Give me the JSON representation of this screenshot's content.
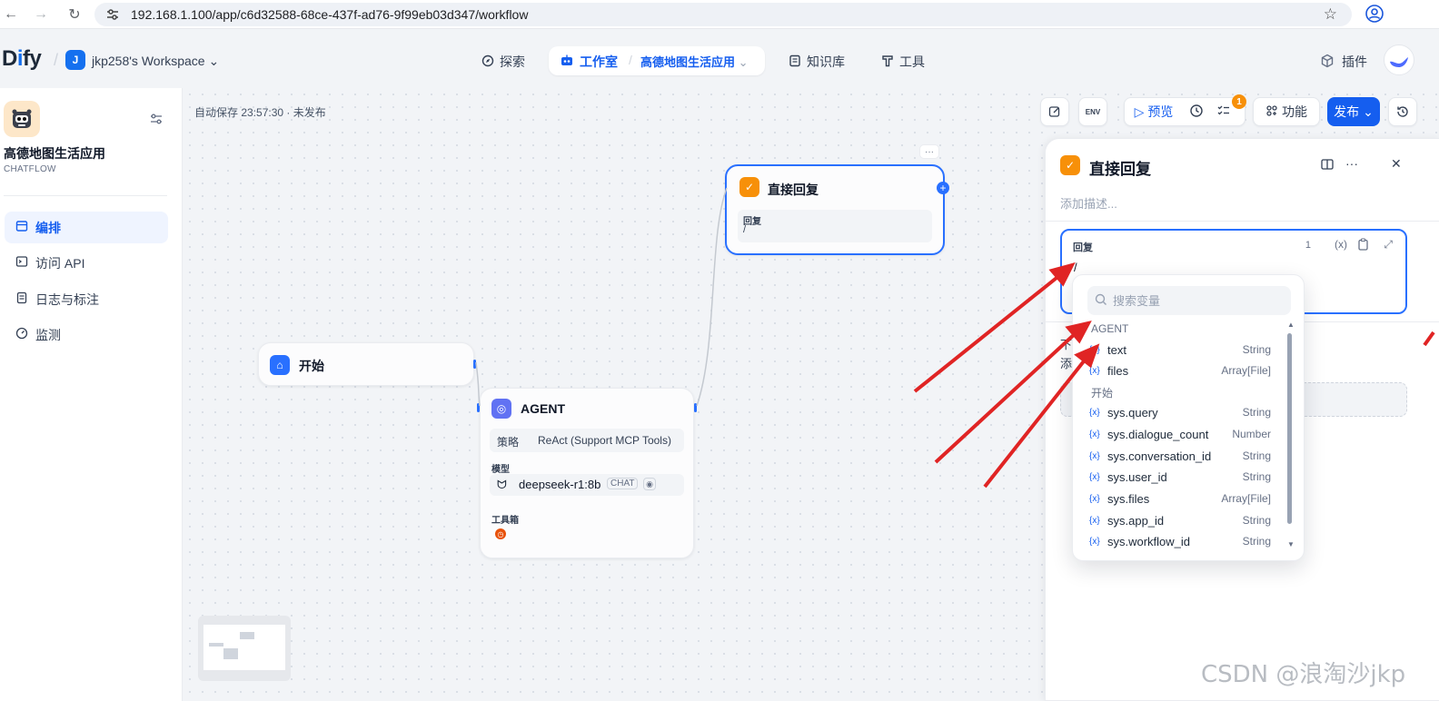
{
  "browser": {
    "url": "192.168.1.100/app/c6d32588-68ce-437f-ad76-9f99eb03d347/workflow"
  },
  "header": {
    "logo_prefix": "D",
    "logo_i": "i",
    "logo_suffix": "fy",
    "workspace_initial": "J",
    "workspace_name": "jkp258's Workspace",
    "nav": {
      "explore": "探索",
      "studio": "工作室",
      "app_name": "高德地图生活应用",
      "knowledge": "知识库",
      "tools": "工具",
      "plugins": "插件"
    }
  },
  "sidebar": {
    "app_title": "高德地图生活应用",
    "app_type": "CHATFLOW",
    "items": [
      {
        "label": "编排",
        "icon": "layout-icon"
      },
      {
        "label": "访问 API",
        "icon": "terminal-icon"
      },
      {
        "label": "日志与标注",
        "icon": "document-icon"
      },
      {
        "label": "监测",
        "icon": "gauge-icon"
      }
    ]
  },
  "canvas": {
    "autosave": "自动保存 23:57:30 · 未发布",
    "toolbar": {
      "preview": "预览",
      "features": "功能",
      "publish": "发布",
      "env": "ENV",
      "checklist_badge": "1"
    },
    "nodes": {
      "start": {
        "title": "开始"
      },
      "agent": {
        "title": "AGENT",
        "strategy_label": "策略",
        "strategy_value": "ReAct (Support MCP Tools)",
        "model_label": "模型",
        "model_name": "deepseek-r1:8b",
        "model_tag": "CHAT",
        "tools_label": "工具箱"
      },
      "answer": {
        "title": "直接回复",
        "reply_label": "回复",
        "reply_value": "/"
      }
    }
  },
  "panel": {
    "title": "直接回复",
    "description_placeholder": "添加描述...",
    "editor_label": "回复",
    "editor_count": "1",
    "editor_value": "/",
    "var_icon": "(x)",
    "behind_next_1": "下",
    "behind_next_2": "添"
  },
  "dropdown": {
    "search_placeholder": "搜索变量",
    "groups": [
      {
        "name": "AGENT",
        "vars": [
          {
            "name": "text",
            "type": "String"
          },
          {
            "name": "files",
            "type": "Array[File]"
          }
        ]
      },
      {
        "name": "开始",
        "vars": [
          {
            "name": "sys.query",
            "type": "String"
          },
          {
            "name": "sys.dialogue_count",
            "type": "Number"
          },
          {
            "name": "sys.conversation_id",
            "type": "String"
          },
          {
            "name": "sys.user_id",
            "type": "String"
          },
          {
            "name": "sys.files",
            "type": "Array[File]"
          },
          {
            "name": "sys.app_id",
            "type": "String"
          },
          {
            "name": "sys.workflow_id",
            "type": "String"
          }
        ]
      }
    ]
  },
  "watermark": "CSDN @浪淘沙jkp",
  "colors": {
    "accent": "#155eef",
    "answer_node": "#f79009",
    "agent_node": "#6172f3",
    "start_node": "#2970ff",
    "arrow": "#e02424"
  }
}
